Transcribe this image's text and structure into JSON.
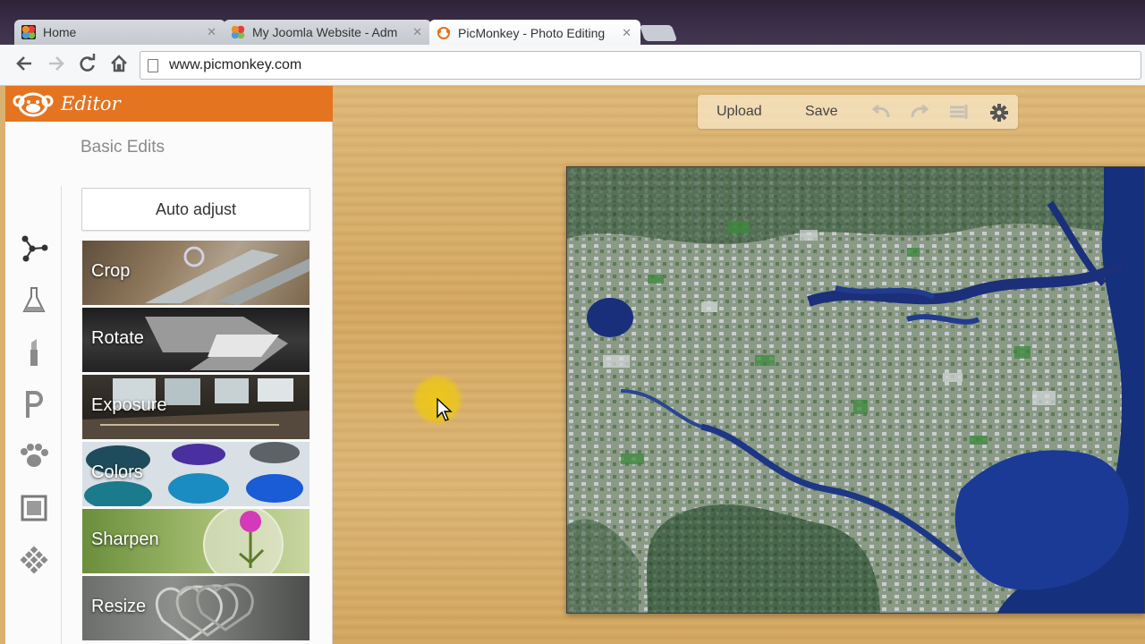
{
  "browser": {
    "tabs": [
      {
        "label": "Home",
        "favicon": "joomla-icon",
        "active": false
      },
      {
        "label": "My Joomla Website - Adm",
        "favicon": "joomla-icon",
        "active": false
      },
      {
        "label": "PicMonkey - Photo Editing",
        "favicon": "picmonkey-icon",
        "active": true
      }
    ],
    "url": "www.picmonkey.com"
  },
  "editor": {
    "title": "Editor",
    "section_title": "Basic Edits",
    "auto_adjust_label": "Auto adjust",
    "rail_icons": [
      "basic-edits-icon",
      "effects-icon",
      "touch-up-icon",
      "text-icon",
      "overlays-icon",
      "frames-icon",
      "textures-icon"
    ],
    "tools": [
      {
        "label": "Crop",
        "theme": "scissors"
      },
      {
        "label": "Rotate",
        "theme": "arrow"
      },
      {
        "label": "Exposure",
        "theme": "windows"
      },
      {
        "label": "Colors",
        "theme": "paint"
      },
      {
        "label": "Sharpen",
        "theme": "flower"
      },
      {
        "label": "Resize",
        "theme": "hearts"
      }
    ],
    "accent_color": "#e4741f"
  },
  "canvas_toolbar": {
    "upload_label": "Upload",
    "save_label": "Save",
    "icons": [
      "undo-icon",
      "redo-icon",
      "history-icon",
      "settings-gear-icon"
    ]
  },
  "photo": {
    "subject": "satellite map"
  }
}
